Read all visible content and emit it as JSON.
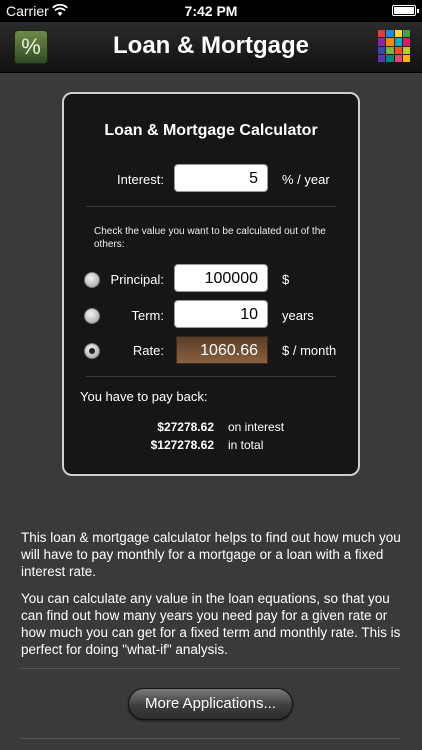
{
  "status_bar": {
    "carrier": "Carrier",
    "time": "7:42 PM"
  },
  "navbar": {
    "title": "Loan & Mortgage",
    "left_icon_text": "%"
  },
  "calculator": {
    "heading": "Loan & Mortgage Calculator",
    "interest": {
      "label": "Interest:",
      "value": "5",
      "unit": "% / year"
    },
    "hint": "Check the value you want to be calculated out of the others:",
    "principal": {
      "label": "Principal:",
      "value": "100000",
      "unit": "$",
      "selected": false
    },
    "term": {
      "label": "Term:",
      "value": "10",
      "unit": "years",
      "selected": false
    },
    "rate": {
      "label": "Rate:",
      "value": "1060.66",
      "unit": "$ / month",
      "selected": true
    },
    "payback_label": "You have to pay back:",
    "on_interest": {
      "amount": "$27278.62",
      "label": "on interest"
    },
    "in_total": {
      "amount": "$127278.62",
      "label": "in total"
    }
  },
  "description": {
    "p1": "This loan & mortgage calculator helps to find out how much you will have to pay monthly for a mortgage or a loan with a fixed interest rate.",
    "p2": "You can calculate any value in the loan equations, so that you can find out how many years you need pay for a given rate or how much you can get for a fixed term and monthly rate. This is perfect for doing \"what-if\" analysis."
  },
  "more_button": "More Applications...",
  "app_grid_colors": [
    "#e53935",
    "#1e88e5",
    "#fdd835",
    "#43a047",
    "#8e24aa",
    "#fb8c00",
    "#00acc1",
    "#d81b60",
    "#3949ab",
    "#7cb342",
    "#f4511e",
    "#c0ca33",
    "#5e35b1",
    "#00897b",
    "#ec407a",
    "#ffb300"
  ]
}
